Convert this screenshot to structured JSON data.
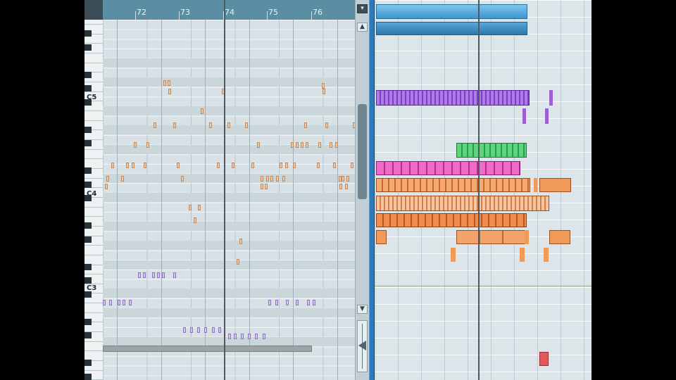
{
  "ruler": {
    "bars": [
      "72",
      "73",
      "74",
      "75",
      "76"
    ]
  },
  "keyboard": {
    "labels": [
      "C5",
      "C4",
      "C3"
    ]
  },
  "scrollbar": {
    "up_glyph": "▲",
    "down_glyph": "▼",
    "menu_glyph": "▾"
  },
  "colors": {
    "note_orange": "#f0c79e",
    "note_violet": "#d4c3f0",
    "lane_blue": "#5aa6d8",
    "lane_purple": "#9b5fd6",
    "lane_green": "#3fbd62",
    "lane_magenta": "#d948b6",
    "lane_orange": "#f09a5a",
    "lane_red": "#e05a5a"
  }
}
